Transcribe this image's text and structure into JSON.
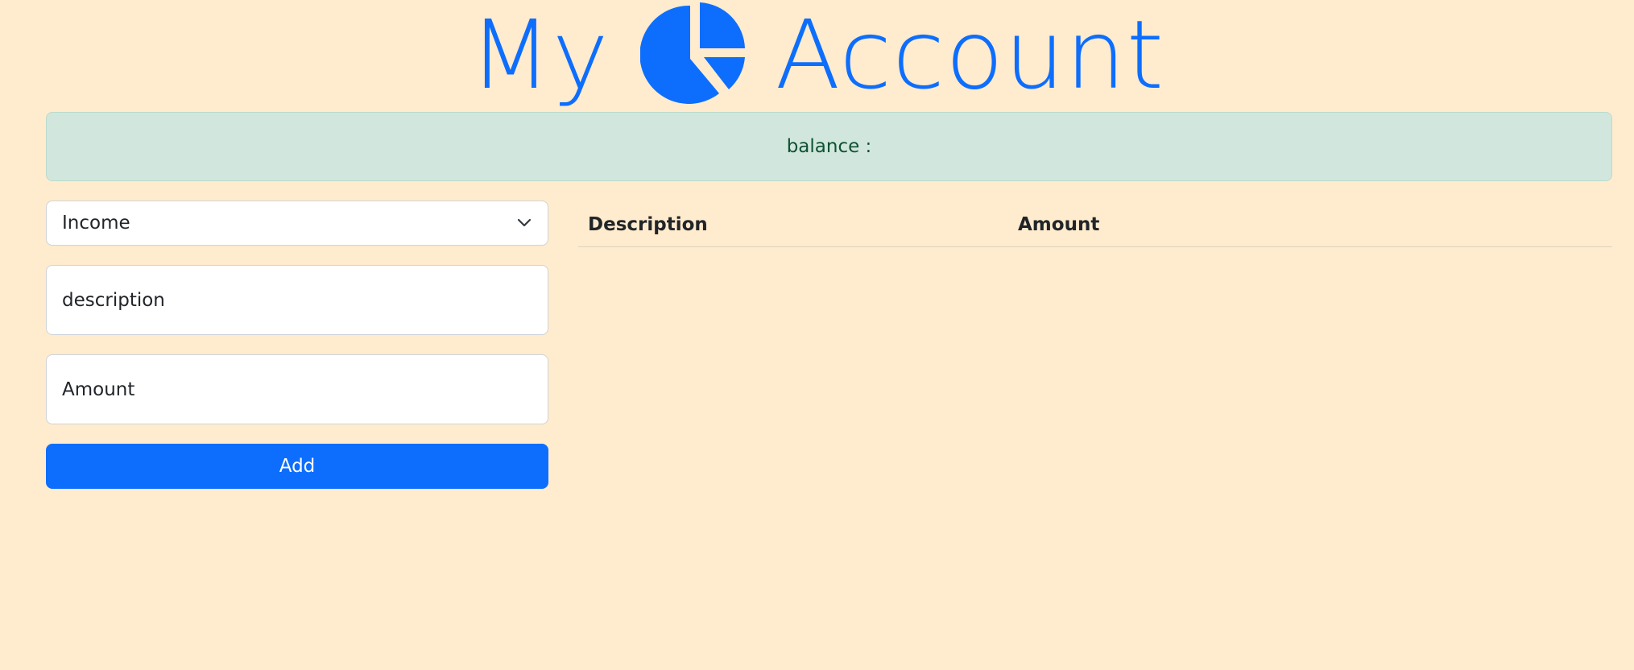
{
  "header": {
    "title_left": "My",
    "title_right": "Account",
    "logo_icon": "pie-chart-icon",
    "accent_color": "#0d6efd"
  },
  "balance": {
    "label": "balance :",
    "value": ""
  },
  "form": {
    "type_select": {
      "selected": "Income",
      "icon": "chevron-down-icon"
    },
    "description_placeholder": "description",
    "amount_placeholder": "Amount",
    "add_label": "Add"
  },
  "table": {
    "columns": [
      "Description",
      "Amount"
    ],
    "rows": []
  },
  "colors": {
    "background": "#ffebcd",
    "balance_bg": "#d1e7dd",
    "balance_text": "#0f5132",
    "button_bg": "#0d6efd"
  }
}
